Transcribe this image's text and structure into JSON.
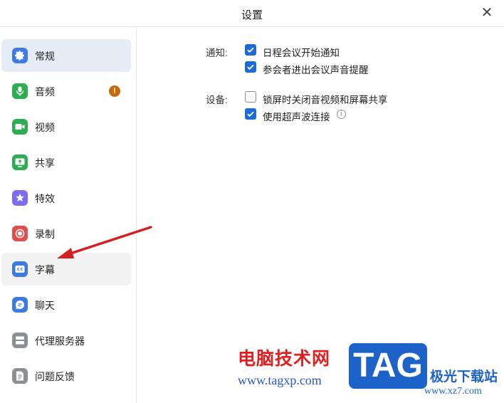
{
  "window": {
    "title": "设置"
  },
  "sidebar": {
    "items": [
      {
        "label": "常规",
        "icon": "gear-icon",
        "color": "#3d7ae6",
        "state": "active"
      },
      {
        "label": "音频",
        "icon": "microphone-icon",
        "color": "#2dae52",
        "alert": "!"
      },
      {
        "label": "视频",
        "icon": "video-camera-icon",
        "color": "#2dae52"
      },
      {
        "label": "共享",
        "icon": "screen-share-icon",
        "color": "#2dae52"
      },
      {
        "label": "特效",
        "icon": "sparkle-icon",
        "color": "#7c6cf0"
      },
      {
        "label": "录制",
        "icon": "record-icon",
        "color": "#e34d4d"
      },
      {
        "label": "字幕",
        "icon": "closed-caption-icon",
        "color": "#3d7ae6",
        "state": "hover"
      },
      {
        "label": "聊天",
        "icon": "chat-bubble-icon",
        "color": "#3d7ae6"
      },
      {
        "label": "代理服务器",
        "icon": "server-icon",
        "color": "#8a8f98"
      },
      {
        "label": "问题反馈",
        "icon": "feedback-icon",
        "color": "#8a8f98"
      }
    ]
  },
  "settings": {
    "notify": {
      "label": "通知:",
      "options": [
        {
          "label": "日程会议开始通知",
          "checked": true
        },
        {
          "label": "参会者进出会议声音提醒",
          "checked": true
        }
      ]
    },
    "device": {
      "label": "设备:",
      "options": [
        {
          "label": "锁屏时关闭音视频和屏幕共享",
          "checked": false
        },
        {
          "label": "使用超声波连接",
          "checked": true,
          "info": "i"
        }
      ]
    }
  },
  "watermark": {
    "site_name": "电脑技术网",
    "site_url": "www.tagxp.com",
    "logo_text": "TAG",
    "partner_name": "极光下载站",
    "partner_url": "www.xz7.com"
  },
  "colors": {
    "accent": "#1f6bd4",
    "arrow": "#d42020"
  }
}
